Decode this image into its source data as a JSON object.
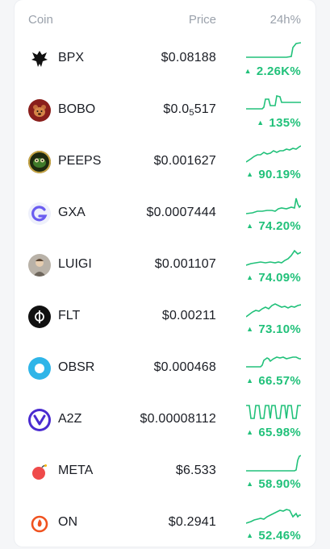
{
  "header": {
    "coin": "Coin",
    "price": "Price",
    "change": "24h%"
  },
  "colors": {
    "positive": "#21c17a",
    "text": "#1a1d24",
    "muted": "#9aa1ab"
  },
  "rows": [
    {
      "symbol": "BPX",
      "price": "$0.08188",
      "price_main": "$0.08188",
      "price_sub": "",
      "price_tail": "",
      "change": "2.26K%",
      "icon": "bpx-phoenix-icon"
    },
    {
      "symbol": "BOBO",
      "price": "$0.0₅517",
      "price_main": "$0.0",
      "price_sub": "5",
      "price_tail": "517",
      "change": "135%",
      "icon": "bobo-bear-icon"
    },
    {
      "symbol": "PEEPS",
      "price": "$0.001627",
      "price_main": "$0.001627",
      "price_sub": "",
      "price_tail": "",
      "change": "90.19%",
      "icon": "peeps-frog-icon"
    },
    {
      "symbol": "GXA",
      "price": "$0.0007444",
      "price_main": "$0.0007444",
      "price_sub": "",
      "price_tail": "",
      "change": "74.20%",
      "icon": "gxa-g-icon"
    },
    {
      "symbol": "LUIGI",
      "price": "$0.001107",
      "price_main": "$0.001107",
      "price_sub": "",
      "price_tail": "",
      "change": "74.09%",
      "icon": "luigi-avatar-icon"
    },
    {
      "symbol": "FLT",
      "price": "$0.00211",
      "price_main": "$0.00211",
      "price_sub": "",
      "price_tail": "",
      "change": "73.10%",
      "icon": "flt-phi-icon"
    },
    {
      "symbol": "OBSR",
      "price": "$0.000468",
      "price_main": "$0.000468",
      "price_sub": "",
      "price_tail": "",
      "change": "66.57%",
      "icon": "obsr-ring-icon"
    },
    {
      "symbol": "A2Z",
      "price": "$0.00008112",
      "price_main": "$0.00008112",
      "price_sub": "",
      "price_tail": "",
      "change": "65.98%",
      "icon": "a2z-shield-icon"
    },
    {
      "symbol": "META",
      "price": "$6.533",
      "price_main": "$6.533",
      "price_sub": "",
      "price_tail": "",
      "change": "58.90%",
      "icon": "meta-bomb-icon"
    },
    {
      "symbol": "ON",
      "price": "$0.2941",
      "price_main": "$0.2941",
      "price_sub": "",
      "price_tail": "",
      "change": "52.46%",
      "icon": "on-flame-icon"
    }
  ]
}
